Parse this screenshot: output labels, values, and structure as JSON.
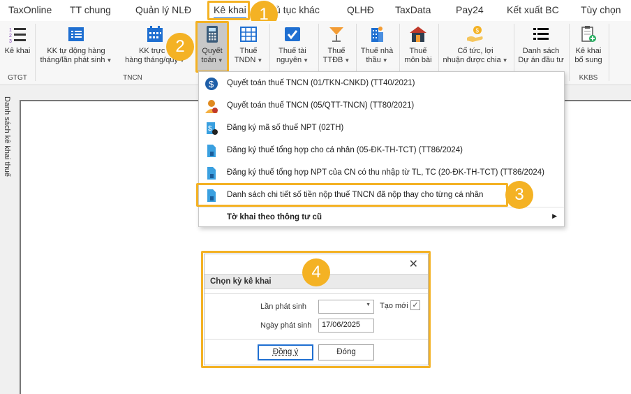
{
  "tabs": [
    "TaxOnline",
    "TT chung",
    "Quản lý NLĐ",
    "Kê khai",
    "ủ tục khác",
    "QLHĐ",
    "TaxData",
    "Pay24",
    "Kết xuất BC",
    "Tùy chọn"
  ],
  "ribbon": {
    "buttons": [
      {
        "line1": "Kê khai",
        "line2": ""
      },
      {
        "line1": "KK tự động hàng",
        "line2": "tháng/lần phát sinh"
      },
      {
        "line1": "KK trực ti",
        "line2": "hàng tháng/quý"
      },
      {
        "line1": "Quyết",
        "line2": "toán"
      },
      {
        "line1": "Thuế",
        "line2": "TNDN"
      },
      {
        "line1": "Thuế tài",
        "line2": "nguyên"
      },
      {
        "line1": "Thuế",
        "line2": "TTĐB"
      },
      {
        "line1": "Thuế nhà",
        "line2": "thầu"
      },
      {
        "line1": "Thuế",
        "line2": "môn bài"
      },
      {
        "line1": "Cổ tức, lợi",
        "line2": "nhuận được chia"
      },
      {
        "line1": "Danh sách",
        "line2": "Dự án đầu tư"
      },
      {
        "line1": "Kê khai",
        "line2": "bổ sung"
      }
    ],
    "groups": [
      "GTGT",
      "TNCN",
      "KKBS"
    ]
  },
  "sidepanel": {
    "label": "Danh sách kê khai thuế"
  },
  "menu": {
    "items": [
      "Quyết toán thuế TNCN (01/TKN-CNKD) (TT40/2021)",
      "Quyết toán thuế TNCN (05/QTT-TNCN) (TT80/2021)",
      "Đăng ký mã số thuế NPT (02TH)",
      "Đăng ký thuế tổng hợp cho cá nhân (05-ĐK-TH-TCT) (TT86/2024)",
      "Đăng ký thuế tổng hợp NPT của CN có thu nhập từ TL, TC (20-ĐK-TH-TCT) (TT86/2024)",
      "Danh sách chi tiết số tiền nộp thuế TNCN đã nộp thay cho từng cá nhân",
      "Tờ khai theo thông tư cũ"
    ]
  },
  "badges": [
    "1",
    "2",
    "3",
    "4"
  ],
  "dialog": {
    "title": "Chọn kỳ kê khai",
    "lan_phat_sinh_label": "Lần phát sinh",
    "lan_phat_sinh_value": "",
    "tao_moi_label": "Tạo mới",
    "ngay_phat_sinh_label": "Ngày phát sinh",
    "ngay_phat_sinh_value": "17/06/2025",
    "ok_label": "Đồng ý",
    "close_label": "Đóng"
  },
  "colors": {
    "highlight": "#f4b224",
    "accent": "#1f6fd1"
  }
}
